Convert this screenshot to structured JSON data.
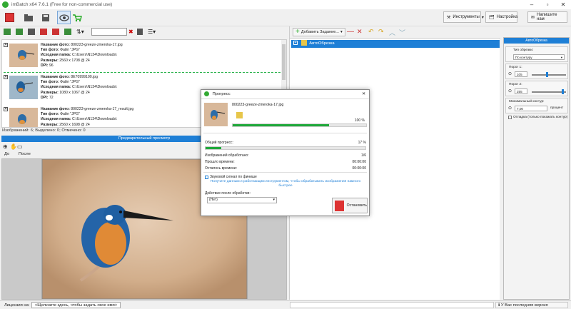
{
  "window": {
    "title": "imBatch x64 7.6.1 (Free for non-commercial use)"
  },
  "toolbar": {
    "tools_label": "Инструменты",
    "settings_label": "Настройка",
    "write_label": "Напишите нам"
  },
  "images": [
    {
      "name_label": "Название фото:",
      "name": "800223-greeze-zmeroka-17.jpg",
      "type_label": "Тип фото:",
      "type": "Файл \"JPG\"",
      "folder_label": "Исходная папка:",
      "folder": "C:\\Users\\N134\\Downloads\\",
      "size_label": "Размеры:",
      "size": "2560 x 1708 @ 24",
      "dpi_label": "DPI:",
      "dpi": "96"
    },
    {
      "name_label": "Название фото:",
      "name": "8E70999100.jpg",
      "type_label": "Тип фото:",
      "type": "Файл \"JPG\"",
      "folder_label": "Исходная папка:",
      "folder": "C:\\Users\\N134\\Downloads\\",
      "size_label": "Размеры:",
      "size": "1080 x 1067 @ 24",
      "dpi_label": "DPI:",
      "dpi": "72"
    },
    {
      "name_label": "Название фото:",
      "name": "800223-greeze-zmeroka-17_result.jpg",
      "type_label": "Тип фото:",
      "type": "Файл \"JPG\"",
      "folder_label": "Исходная папка:",
      "folder": "C:\\Users\\N134\\Downloads\\",
      "size_label": "Размеры:",
      "size": "2560 x 1698 @ 24",
      "dpi_label": "DPI:",
      "dpi": ""
    }
  ],
  "status": {
    "text": "Изображений: 6; Выделено: 0; Отмечено: 0"
  },
  "preview": {
    "bar_title": "Предварительный просмотр",
    "before_label": "До",
    "after_label": "После"
  },
  "tasks": {
    "add_task_label": "Добавить Задание...",
    "item_label": "АвтоОбрезка"
  },
  "autocrop": {
    "title": "АвтоОбрезка",
    "crop_type_label": "Тип обрезки:",
    "crop_type_value": "По контуру",
    "threshold1_label": "Порог 1:",
    "threshold1_value": "105",
    "threshold2_label": "Порог 2:",
    "threshold2_value": "255",
    "min_size_label": "Минимальный контур:",
    "min_size_value": "7,00",
    "min_size_unit": "процент",
    "checkbox_label": "Отладка (только покажать контур)"
  },
  "dialog": {
    "title": "Прогресс",
    "filename": "800223-greeze-zmeroka-17.jpg",
    "file_percent": "100 %",
    "file_progress": 0.72,
    "overall_label": "Общий прогресс:",
    "overall_percent": "17 %",
    "overall_progress": 0.1,
    "processed_label": "Изображений обработано:",
    "processed_value": "1/6",
    "elapsed_label": "Прошло времени:",
    "elapsed_value": "00:00:00",
    "remaining_label": "Осталось времени:",
    "remaining_value": "00:00:00",
    "sound_label": "Звуковой сигнал по финише",
    "hint": "Получите данным и работающим инструментом, чтобы обрабатывать изображения намного быстрее",
    "after_label": "Действие после обработки:",
    "after_value": "(Нет)",
    "stop_label": "Остановить"
  },
  "bottom": {
    "license_label": "Лицензия на:",
    "license_field": "<Щелкните здесь, чтобы задать свое имя>",
    "version_text": "У Вас последняя версия"
  },
  "colors": {
    "accent": "#1e7fd6",
    "progress": "#1fa83a",
    "stop": "#d33333"
  }
}
